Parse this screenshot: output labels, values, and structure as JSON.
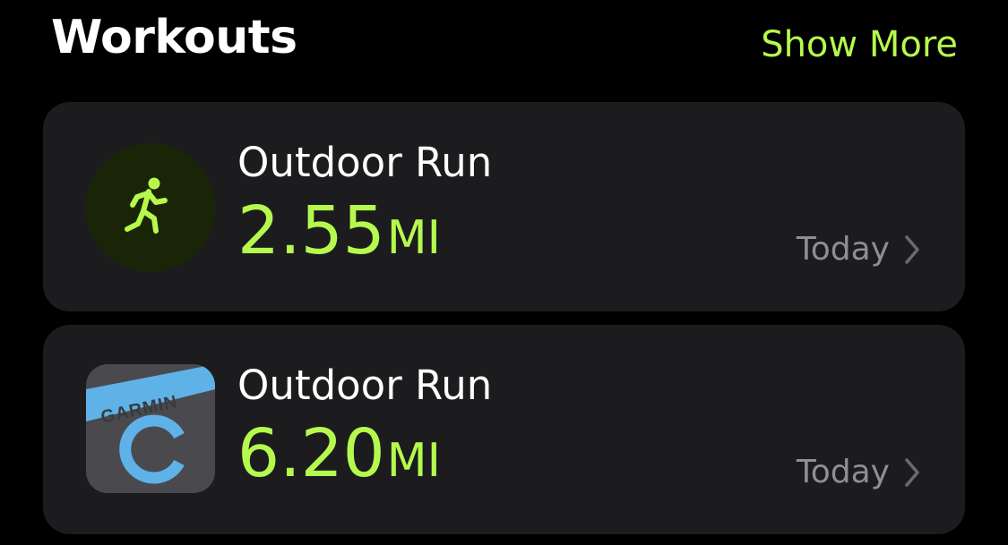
{
  "header": {
    "title": "Workouts",
    "show_more_label": "Show More"
  },
  "workouts": [
    {
      "name": "Outdoor Run",
      "distance_value": "2.55",
      "distance_unit": "MI",
      "date": "Today",
      "icon": "running-figure-icon"
    },
    {
      "name": "Outdoor Run",
      "distance_value": "6.20",
      "distance_unit": "MI",
      "date": "Today",
      "icon": "garmin-app-icon",
      "icon_brand_text": "GARMIN"
    }
  ],
  "colors": {
    "accent": "#b6f94e",
    "card_background": "#1c1c1e",
    "secondary_text": "#8e8e93",
    "garmin_blue": "#5eb2e8"
  }
}
